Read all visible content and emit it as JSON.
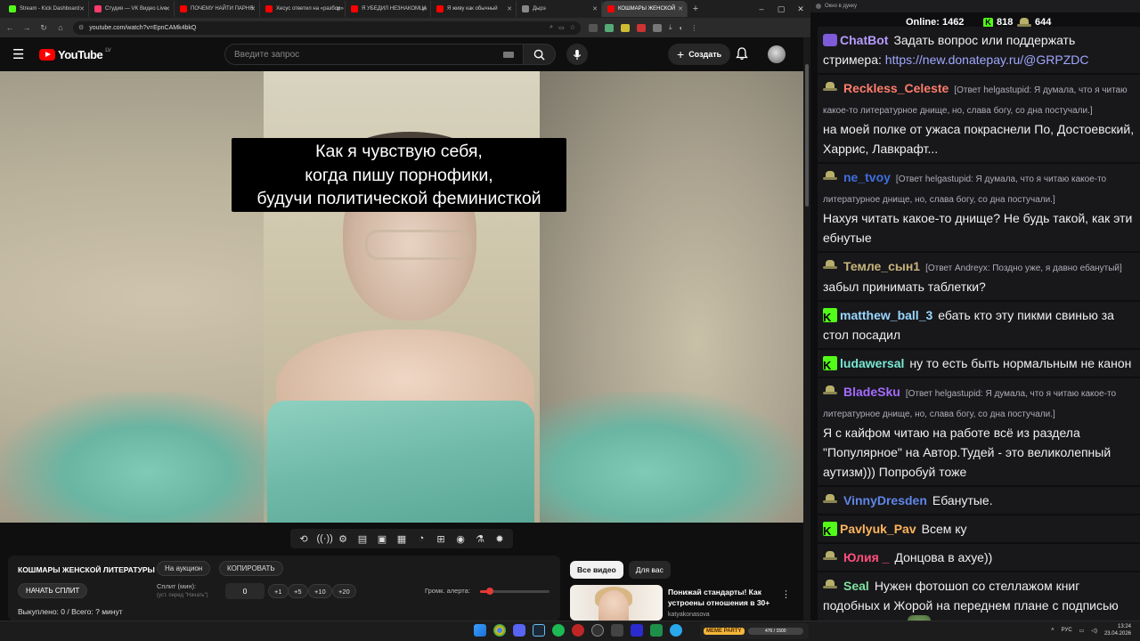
{
  "browser": {
    "tabs": [
      {
        "label": "Stream - Kick Dashboard",
        "fav": "#53fc18",
        "active": false
      },
      {
        "label": "Студия — VK Видео Live",
        "fav": "#ff3b6b",
        "active": false
      },
      {
        "label": "ПОЧЕМУ НАЙТИ ПАРНЯ",
        "fav": "#ff0000",
        "active": false
      },
      {
        "label": "Хесус ответил на «разбор»",
        "fav": "#ff0000",
        "active": false
      },
      {
        "label": "Я УБЕДИЛ НЕЗНАКОМЦА",
        "fav": "#ff0000",
        "active": false
      },
      {
        "label": "Я живу как обычный",
        "fav": "#ff0000",
        "active": false
      },
      {
        "label": "Дырэ",
        "fav": "#888888",
        "active": false
      },
      {
        "label": "КОШМАРЫ ЖЕНСКОЙ",
        "fav": "#ff0000",
        "active": true
      }
    ],
    "url": "youtube.com/watch?v=EpnCAMk4bkQ"
  },
  "youtube": {
    "logo_text": "YouTube",
    "region": "LV",
    "search_placeholder": "Введите запрос",
    "create_label": "Создать",
    "caption_lines": [
      "Как я чувствую себя,",
      "когда пишу порнофики,",
      "будучи политической феминисткой"
    ],
    "auction": {
      "title": "КОШМАРЫ ЖЕНСКОЙ ЛИТЕРАТУРЫ",
      "to_auction": "На аукцион",
      "copy": "КОПИРОВАТЬ",
      "start_split": "НАЧАТЬ СПЛИТ",
      "split_label": "Сплит (мин):",
      "split_hint": "(уст. перед \"Начать\")",
      "split_value": "0",
      "steps": [
        "+1",
        "+5",
        "+10",
        "+20"
      ],
      "volume_label": "Громк. алерта:",
      "volume_fraction": 0.14,
      "bought": "Выкуплено: 0 / Всего: ? минут"
    },
    "chips": [
      "Все видео",
      "Для вас"
    ],
    "recommendation": {
      "title": "Понижай стандарты! Как устроены отношения в 30+",
      "channel": "katyakonasova"
    }
  },
  "chat": {
    "window_title": "Окно в дунку",
    "online_label": "Online:",
    "online_count": "1462",
    "kick_count": "818",
    "other_count": "644",
    "messages": [
      {
        "user": "ChatBot",
        "color": "#b79cff",
        "badge": "bot",
        "reply": "",
        "text": "Задать вопрос или поддержать стримера: ",
        "link": "https://new.donatepay.ru/@GRPZDC"
      },
      {
        "user": "Reckless_Celeste",
        "color": "#ff7d6b",
        "badge": "hat",
        "reply": "[Ответ helgastupid: Я думала, что я читаю какое-то литературное днище, но, слава богу, со дна постучали.]",
        "text": "на моей полке от ужаса покраснели По, Достоевский, Харрис, Лавкрафт..."
      },
      {
        "user": "ne_tvoy",
        "color": "#3f6fe0",
        "badge": "hat",
        "reply": "[Ответ helgastupid: Я думала, что я читаю какое-то литературное днище, но, слава богу, со дна постучали.]",
        "text": "Нахуя читать какое-то днище? Не будь такой, как эти ебнутые"
      },
      {
        "user": "Темле_сын1",
        "color": "#c7b37a",
        "badge": "hat",
        "reply": "[Ответ Andreyx: Поздно уже, я давно ебанутый]",
        "text": "забыл принимать таблетки?"
      },
      {
        "user": "matthew_ball_3",
        "color": "#9ad7ff",
        "badge": "kick",
        "reply": "",
        "text": "ебать кто эту пикми свинью за стол посадил"
      },
      {
        "user": "ludawersal",
        "color": "#78e9d4",
        "badge": "kick",
        "reply": "",
        "text": "ну то есть быть нормальным не канон"
      },
      {
        "user": "BladeSku",
        "color": "#a56bff",
        "badge": "hat",
        "reply": "[Ответ helgastupid: Я думала, что я читаю какое-то литературное днище, но, слава богу, со дна постучали.]",
        "text": "Я с кайфом читаю на работе всё из раздела \"Популярное\" на Автор.Тудей - это великолепный аутизм))) Попробуй тоже"
      },
      {
        "user": "VinnyDresden",
        "color": "#5f86e8",
        "badge": "hat",
        "reply": "",
        "text": "Ебанутые."
      },
      {
        "user": "Pavlyuk_Pav",
        "color": "#ffb55c",
        "badge": "kick",
        "reply": "",
        "text": "Всем ку"
      },
      {
        "user": "Юлия _",
        "color": "#ff4f7c",
        "badge": "hat",
        "reply": "",
        "text": "Донцова в ахуе))"
      },
      {
        "user": "Seal",
        "color": "#7fe0a0",
        "badge": "hat",
        "reply": "",
        "text": "Нужен фотошоп со стеллажом книг подобных и Жорой на переднем плане с подписью Читаю и дрочу",
        "emote": true
      }
    ]
  },
  "taskbar": {
    "meme_label": "MEME PARTY",
    "meme_progress": "476 / 1500",
    "lang": "РУС",
    "time": "13:24",
    "date": "23.04.2026"
  },
  "colors": {
    "youtube_red": "#ff0000",
    "kick_green": "#53fc18",
    "chat_bg": "#18181b"
  }
}
